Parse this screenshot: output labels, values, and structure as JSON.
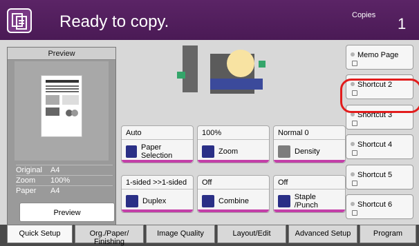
{
  "header": {
    "status": "Ready to copy.",
    "copies_label": "Copies",
    "copies_value": "1"
  },
  "preview_panel": {
    "title": "Preview",
    "info": [
      {
        "key": "Original",
        "value": "A4"
      },
      {
        "key": "Zoom",
        "value": "100%"
      },
      {
        "key": "Paper",
        "value": "A4"
      }
    ],
    "preview_button": "Preview"
  },
  "settings_grid": [
    {
      "top": "Auto",
      "bottom": "Paper\nSelection",
      "icon": "paper-selection-icon"
    },
    {
      "top": "100%",
      "bottom": "Zoom",
      "icon": "zoom-icon"
    },
    {
      "top": "Normal 0",
      "bottom": "Density",
      "icon": "density-icon"
    },
    {
      "top": "1-sided\n>>1-sided",
      "bottom": "Duplex",
      "icon": "duplex-icon"
    },
    {
      "top": "Off",
      "bottom": "Combine",
      "icon": "combine-icon"
    },
    {
      "top": "Off",
      "bottom": "Staple\n/Punch",
      "icon": "staple-punch-icon"
    }
  ],
  "shortcuts": [
    "Memo Page",
    "Shortcut 2",
    "Shortcut 3",
    "Shortcut 4",
    "Shortcut 5",
    "Shortcut 6"
  ],
  "tabs": [
    {
      "label": "Quick Setup",
      "active": true
    },
    {
      "label": "Org./Paper/\nFinishing",
      "active": false
    },
    {
      "label": "Image Quality",
      "active": false
    },
    {
      "label": "Layout/Edit",
      "active": false
    },
    {
      "label": "Advanced\nSetup",
      "active": false
    },
    {
      "label": "Program",
      "active": false
    }
  ],
  "colors": {
    "header": "#4a1a55",
    "accent": "#c33fa8",
    "highlight": "#e21c1c"
  }
}
